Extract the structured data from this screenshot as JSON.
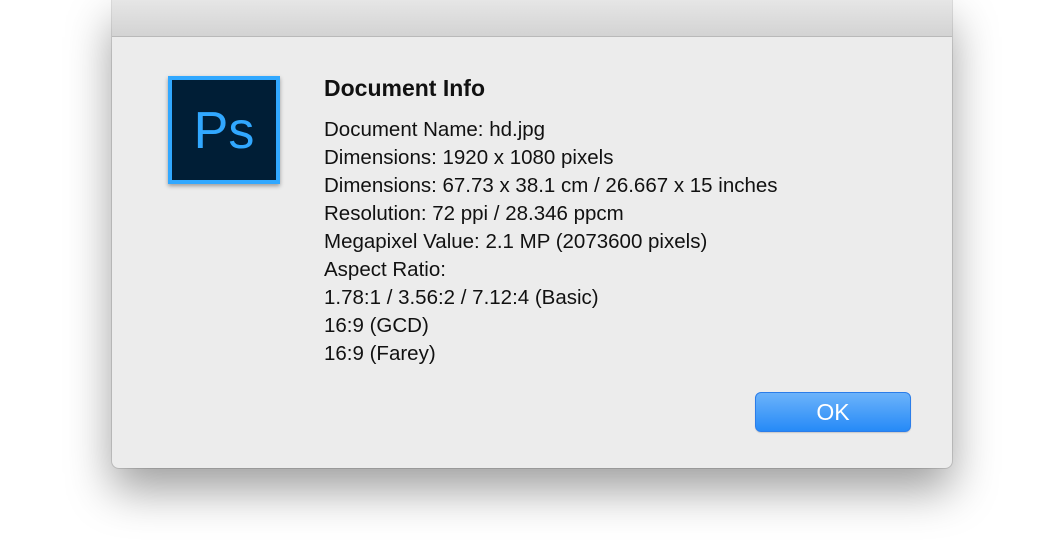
{
  "dialog": {
    "title": "Document Info",
    "lines": [
      "Document Name: hd.jpg",
      "Dimensions: 1920 x 1080 pixels",
      "Dimensions: 67.73 x 38.1 cm / 26.667 x 15 inches",
      "Resolution: 72 ppi / 28.346 ppcm",
      "Megapixel Value: 2.1 MP (2073600 pixels)",
      "Aspect Ratio:",
      "1.78:1 / 3.56:2 / 7.12:4 (Basic)",
      "16:9 (GCD)",
      "16:9 (Farey)"
    ],
    "ok_label": "OK"
  },
  "app_icon": {
    "icon": "photoshop-app-icon",
    "text": "Ps",
    "background_color": "#001e36",
    "accent_color": "#31a8ff"
  },
  "colors": {
    "dialog_background": "#ececec",
    "button_blue": "#268af7"
  }
}
